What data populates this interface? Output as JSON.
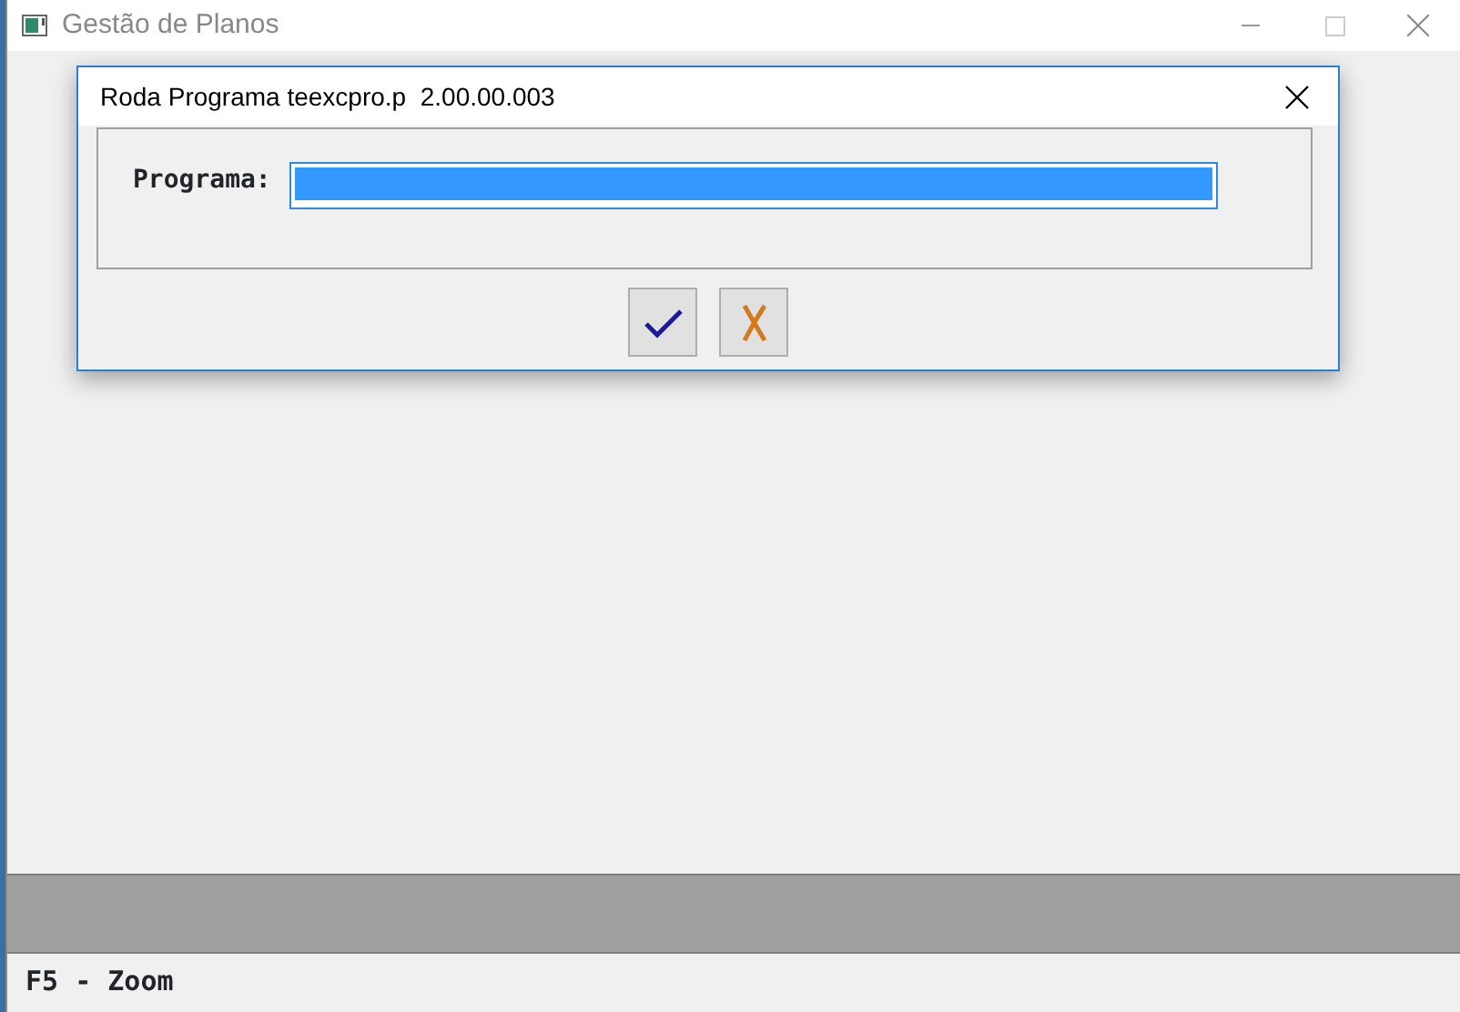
{
  "window": {
    "title": "Gestão de Planos"
  },
  "dialog": {
    "title": "Roda Programa teexcpro.p  2.00.00.003",
    "field": {
      "label": "Programa:",
      "selected": true
    },
    "buttons": [
      {
        "kind": "ok"
      },
      {
        "kind": "cancel"
      }
    ]
  },
  "status_bar": {
    "text": "F5 - Zoom"
  }
}
